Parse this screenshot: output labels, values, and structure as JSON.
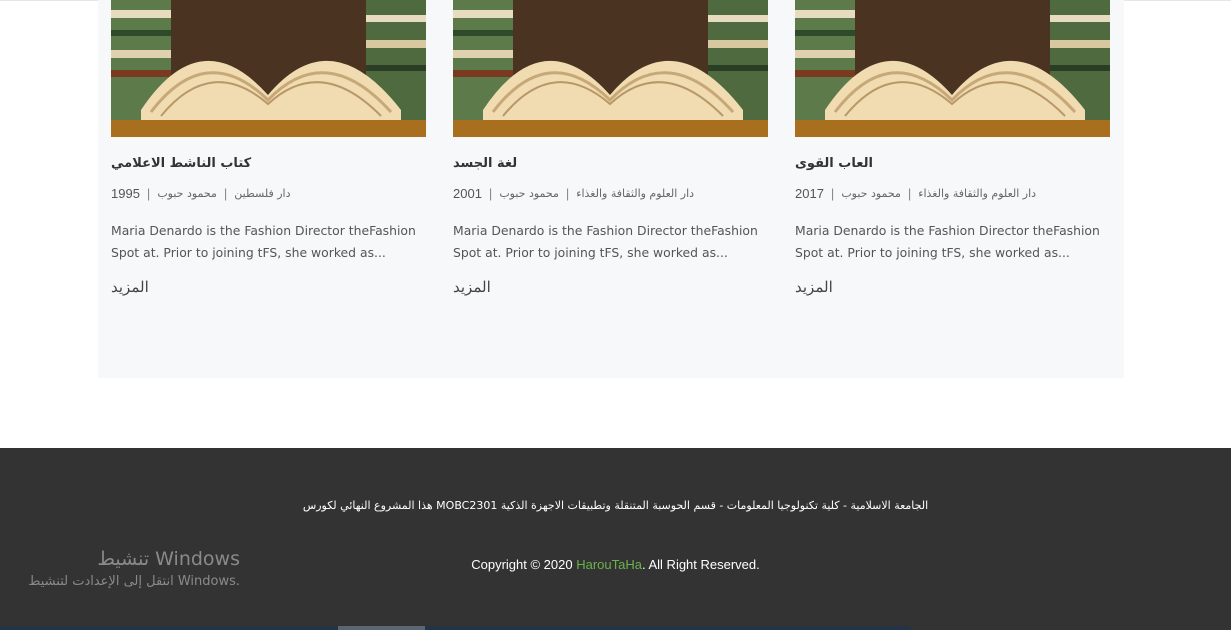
{
  "cards": [
    {
      "title": "كتاب الناشط الاعلامي",
      "year": "1995",
      "author": "محمود حبوب",
      "publisher": "دار فلسطين",
      "description": "Maria Denardo is the Fashion Director theFashion Spot at. Prior to joining tFS, she worked as...",
      "more_label": "المزيد"
    },
    {
      "title": "لغة الجسد",
      "year": "2001",
      "author": "محمود حبوب",
      "publisher": "دار العلوم والثقافة والغذاء",
      "description": "Maria Denardo is the Fashion Director theFashion Spot at. Prior to joining tFS, she worked as...",
      "more_label": "المزيد"
    },
    {
      "title": "العاب القوى",
      "year": "2017",
      "author": "محمود حبوب",
      "publisher": "دار العلوم والثقافة والغذاء",
      "description": "Maria Denardo is the Fashion Director theFashion Spot at. Prior to joining tFS, she worked as...",
      "more_label": "المزيد"
    }
  ],
  "meta_separator": "|",
  "footer": {
    "note": "هذا المشروع النهائي لكورس MOBC2301 الجامعة الاسلامية - كلية تكنولوجيا المعلومات - قسم الحوسبة المتنقلة وتطبيقات الاجهزة الذكية",
    "copyright_prefix": "Copyright © 2020 ",
    "brand": "HarouTaHa",
    "copyright_suffix": ". All Right Reserved."
  },
  "windows_activation": {
    "title": "تنشيط Windows",
    "subtitle": "انتقل إلى الإعدادت لتنشيط Windows."
  },
  "colors": {
    "panel_bg": "#f7f8fa",
    "footer_bg": "#333333",
    "brand": "#6bb24a"
  }
}
